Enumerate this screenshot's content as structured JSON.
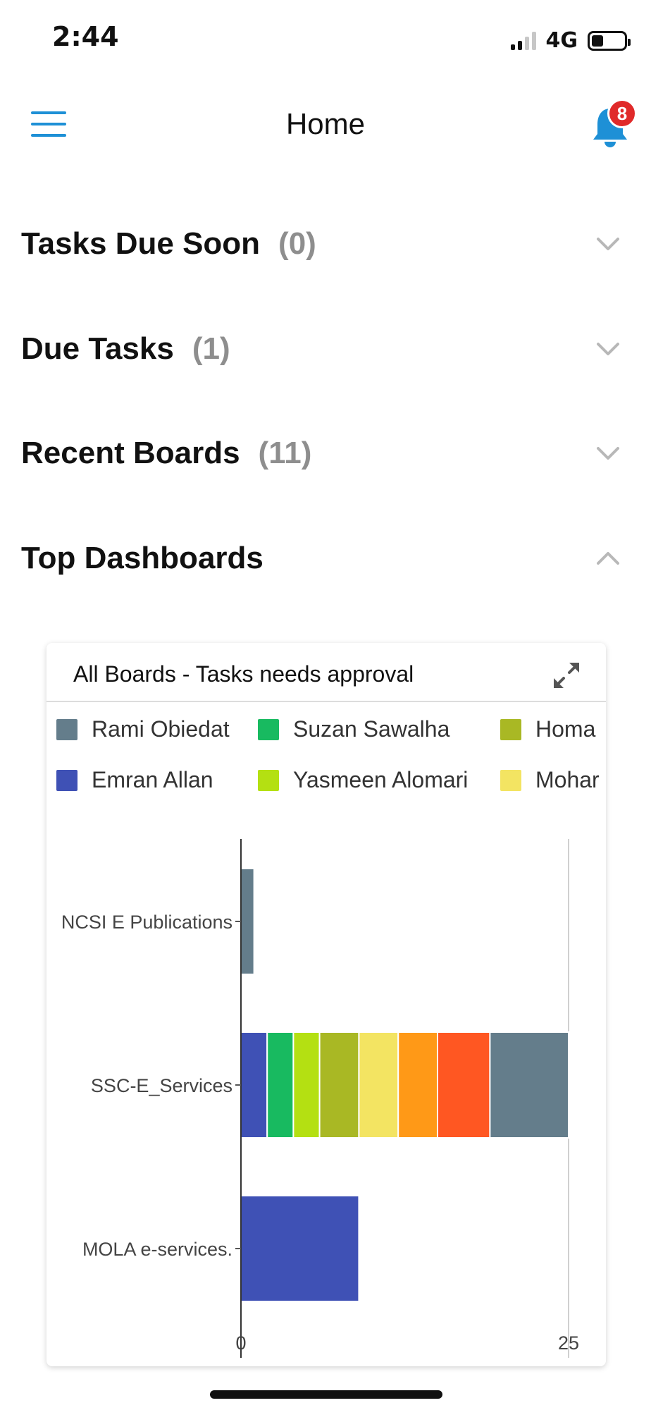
{
  "status_bar": {
    "time": "2:44",
    "network": "4G"
  },
  "header": {
    "title": "Home",
    "notification_count": "8"
  },
  "sections": [
    {
      "label": "Tasks Due Soon",
      "count": "(0)",
      "expanded": false
    },
    {
      "label": "Due Tasks",
      "count": "(1)",
      "expanded": false
    },
    {
      "label": "Recent Boards",
      "count": "(11)",
      "expanded": false
    },
    {
      "label": "Top Dashboards",
      "count": "",
      "expanded": true
    }
  ],
  "card": {
    "title": "All Boards - Tasks needs approval"
  },
  "legend": [
    {
      "name": "Rami Obiedat",
      "color": "#647d8b"
    },
    {
      "name": "Suzan Sawalha",
      "color": "#18ba60"
    },
    {
      "name": "Homa",
      "color": "#a9b824"
    },
    {
      "name": "Emran Allan",
      "color": "#3f51b5"
    },
    {
      "name": "Yasmeen Alomari",
      "color": "#b4e012"
    },
    {
      "name": "Mohar",
      "color": "#f3e462"
    }
  ],
  "chart_data": {
    "type": "bar",
    "orientation": "horizontal",
    "stacked": true,
    "categories": [
      "NCSI E Publications",
      "SSC-E_Services",
      "MOLA e-services."
    ],
    "xlim": [
      0,
      25
    ],
    "x_ticks": [
      "0",
      "25"
    ],
    "segments": [
      [
        {
          "color": "#647d8b",
          "value": 1
        }
      ],
      [
        {
          "color": "#3f51b5",
          "value": 2
        },
        {
          "color": "#18ba60",
          "value": 2
        },
        {
          "color": "#b4e012",
          "value": 2
        },
        {
          "color": "#a9b824",
          "value": 3
        },
        {
          "color": "#f3e462",
          "value": 3
        },
        {
          "color": "#ff9917",
          "value": 3
        },
        {
          "color": "#ff5722",
          "value": 4
        },
        {
          "color": "#647d8b",
          "value": 6
        }
      ],
      [
        {
          "color": "#3f51b5",
          "value": 9
        }
      ]
    ]
  },
  "colors": {
    "accent": "#1e90d6",
    "badge": "#e02a2a",
    "muted": "#8e8e8e"
  }
}
